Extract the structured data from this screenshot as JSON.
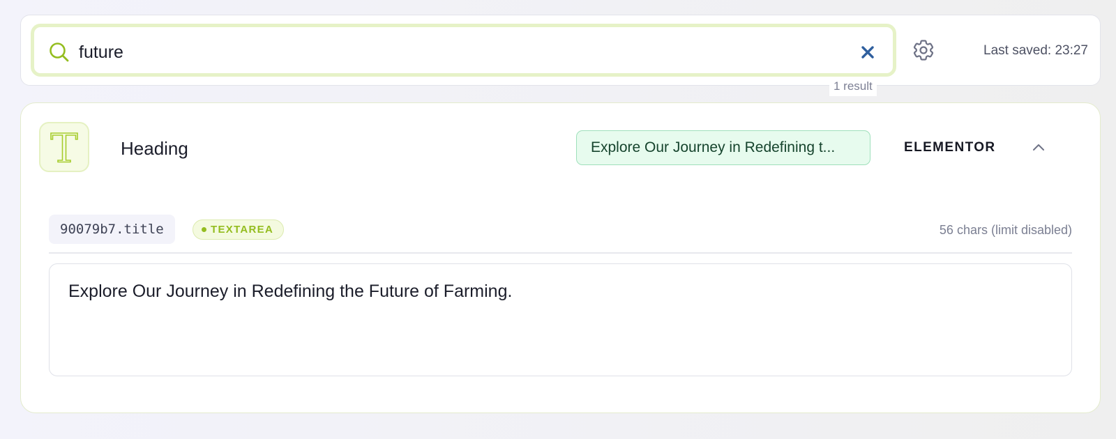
{
  "search": {
    "query": "future",
    "result_count": "1 result"
  },
  "header": {
    "last_saved": "Last saved: 23:27"
  },
  "result": {
    "type_label": "Heading",
    "preview_text": "Explore Our Journey in Redefining t...",
    "source": "ELEMENTOR",
    "field_key": "90079b7.title",
    "field_type": "TEXTAREA",
    "char_info": "56 chars (limit disabled)",
    "value": "Explore Our Journey in Redefining the Future of Farming."
  },
  "icons": {
    "search": "search-icon",
    "clear": "close-icon",
    "settings": "gear-icon",
    "type": "text-type-icon",
    "collapse": "chevron-up-icon"
  },
  "colors": {
    "accent": "#94bd1f",
    "search_focus_ring": "#e6f2c7",
    "preview_pill_bg": "#e7fbee",
    "preview_pill_border": "#9fe0bb",
    "clear_icon": "#2f5f9e"
  }
}
